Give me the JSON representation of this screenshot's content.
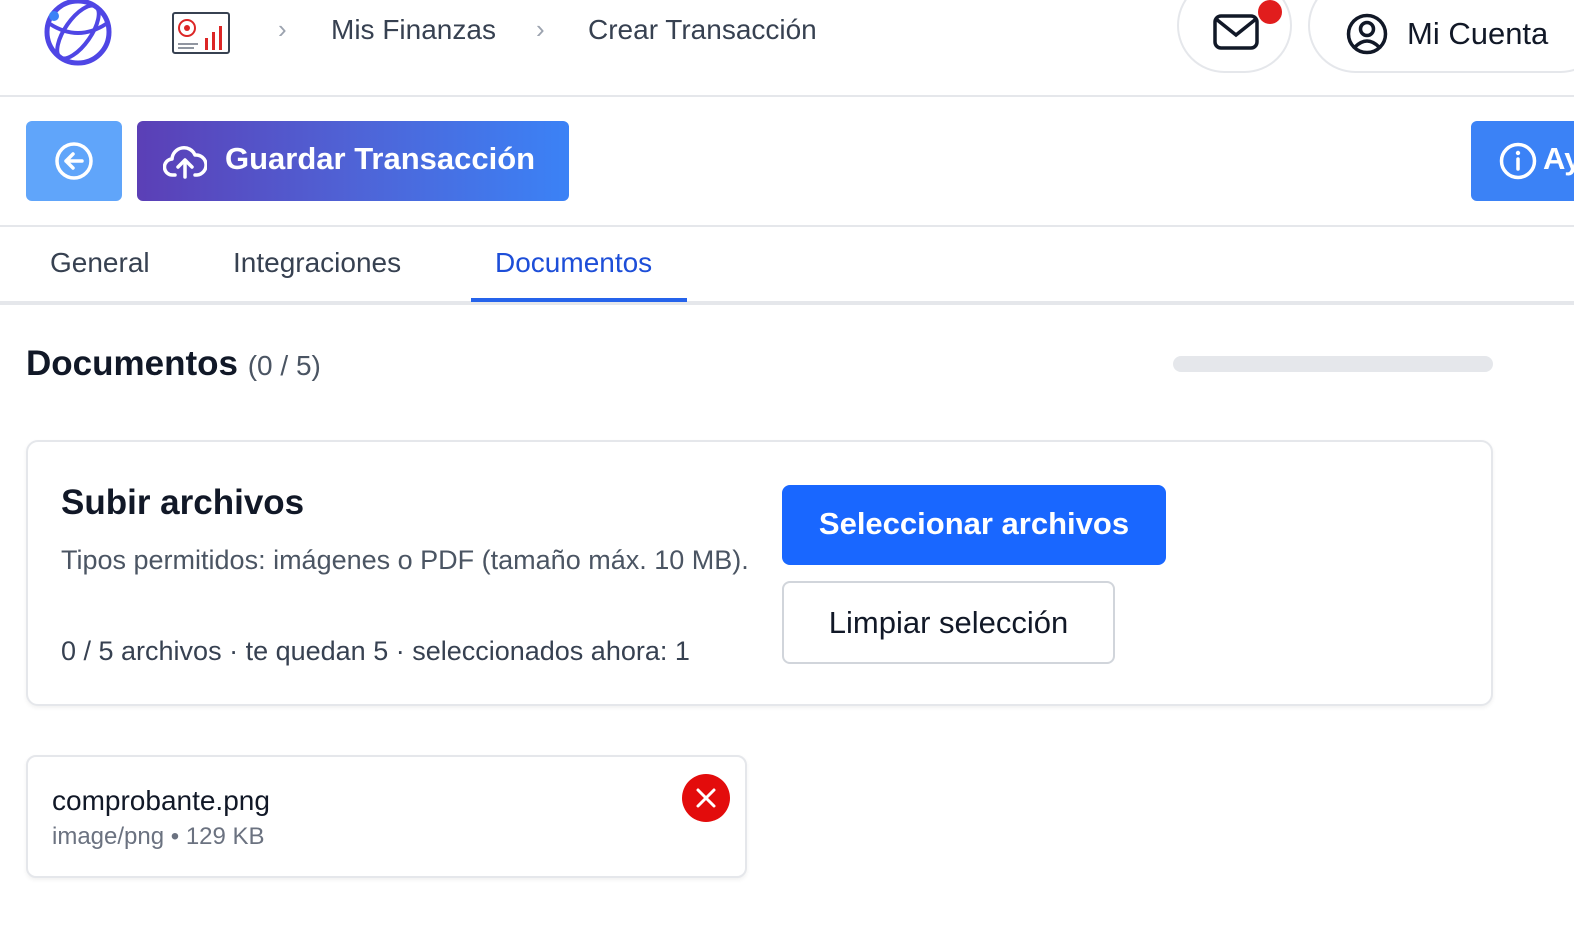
{
  "header": {
    "breadcrumb": [
      "Mis Finanzas",
      "Crear Transacción"
    ],
    "account_label": "Mi Cuenta",
    "icons": {
      "logo": "globe-logo-icon",
      "app": "finance-report-icon",
      "separator": "chevron-right-icon",
      "mail": "mail-icon",
      "account": "user-circle-icon"
    },
    "has_notification": true
  },
  "toolbar": {
    "save_label": "Guardar Transacción",
    "help_label": "Ayuda",
    "icons": {
      "back": "arrow-left-circle-icon",
      "save": "cloud-upload-icon",
      "help": "info-circle-icon"
    }
  },
  "tabs": [
    {
      "label": "General",
      "active": false
    },
    {
      "label": "Integraciones",
      "active": false
    },
    {
      "label": "Documentos",
      "active": true
    }
  ],
  "documents": {
    "title": "Documentos",
    "count_label": "(0 / 5)",
    "progress_fraction": 0
  },
  "upload": {
    "title": "Subir archivos",
    "description": "Tipos permitidos: imágenes o PDF (tamaño máx. 10 MB).",
    "meta": "0 / 5 archivos · te quedan 5 · seleccionados ahora: 1",
    "select_label": "Seleccionar archivos",
    "clear_label": "Limpiar selección"
  },
  "files": [
    {
      "name": "comprobante.png",
      "meta": "image/png • 129 KB",
      "remove_icon": "close-icon"
    }
  ],
  "colors": {
    "primary": "#1967ff",
    "accent_blue": "#3b82f6",
    "gradient_start": "#5b3fb6",
    "danger": "#e30c0c",
    "tab_active": "#1d4ed8"
  }
}
